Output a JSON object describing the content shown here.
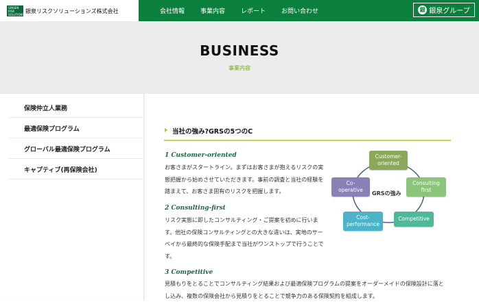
{
  "header": {
    "logo_mark": "GINSEN RISK SOLUTIONS",
    "logo_text": "銀泉リスクソリューションズ株式会社",
    "nav": [
      "会社情報",
      "事業内容",
      "レポート",
      "お問い合わせ"
    ],
    "group_icon": "銀",
    "group_label": "銀泉グループ"
  },
  "hero": {
    "title": "BUSINESS",
    "subtitle": "事業内容"
  },
  "sidebar": {
    "items": [
      {
        "label": "保険仲立人業務"
      },
      {
        "label": "最適保険プログラム"
      },
      {
        "label": "グローバル最適保険プログラム"
      },
      {
        "label": "キャプティブ(再保険会社)"
      }
    ]
  },
  "main": {
    "section_title": "当社の強み?GRSの5つのC",
    "items": [
      {
        "title": "1 Customer-oriented",
        "lines": [
          "お客さまがスタートライン。まずはお客さまが抱えるリスクの実",
          "態把握から始めさせていただきます。事前の調査と当社の経験を",
          "踏まえて、お客さま固有のリスクを把握します。"
        ]
      },
      {
        "title": "2 Consulting-first",
        "lines": [
          "リスク実態に即したコンサルティング・ご提案を初めに行いま",
          "す。他社の保険コンサルティングとの大きな違いは、実地のサー",
          "ベイから最終的な保険手配まで当社がワンストップで行うことで",
          "す。"
        ]
      },
      {
        "title": "3 Competitive",
        "lines": [
          "見積もりをとることでコンサルティング結果および最適保険プログラムの提案をオーダーメイドの保険設計に落と",
          "し込み、複数の保険会社から見積りをとることで競争力のある保険契約を組成します。"
        ]
      }
    ],
    "diagram": {
      "center": "GRSの強み",
      "boxes": [
        {
          "label": "Customer-oriented",
          "line1": "Customer-",
          "line2": "oriented",
          "color": "#8ba85a"
        },
        {
          "label": "Consulting first",
          "line1": "Consulting",
          "line2": "first",
          "color": "#8cc47a"
        },
        {
          "label": "Competitive",
          "line1": "Competitive",
          "line2": "",
          "color": "#4fb79a"
        },
        {
          "label": "Cost-performance",
          "line1": "Cost-",
          "line2": "performance",
          "color": "#4cb3c8"
        },
        {
          "label": "Co-operative",
          "line1": "Co-",
          "line2": "operative",
          "color": "#8a80b6"
        }
      ],
      "ring_color": "#4a5a8a"
    }
  }
}
